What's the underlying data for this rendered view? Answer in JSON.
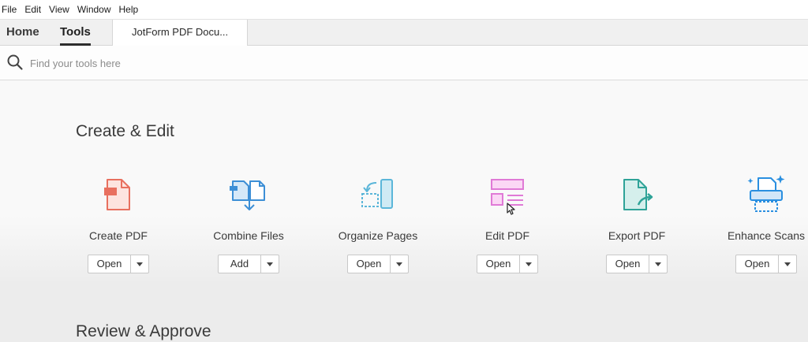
{
  "menu": [
    "File",
    "Edit",
    "View",
    "Window",
    "Help"
  ],
  "tabs": {
    "home": "Home",
    "tools": "Tools",
    "document": "JotForm PDF Docu..."
  },
  "search": {
    "placeholder": "Find your tools here"
  },
  "sections": {
    "create_edit": "Create & Edit",
    "review_approve": "Review & Approve"
  },
  "tools": [
    {
      "label": "Create PDF",
      "action": "Open",
      "icon": "create-pdf-icon",
      "color": "#e8705f"
    },
    {
      "label": "Combine Files",
      "action": "Add",
      "icon": "combine-files-icon",
      "color": "#3d8fd6"
    },
    {
      "label": "Organize Pages",
      "action": "Open",
      "icon": "organize-pages-icon",
      "color": "#5bb6d9"
    },
    {
      "label": "Edit PDF",
      "action": "Open",
      "icon": "edit-pdf-icon",
      "color": "#e07ad6"
    },
    {
      "label": "Export PDF",
      "action": "Open",
      "icon": "export-pdf-icon",
      "color": "#2fa398"
    },
    {
      "label": "Enhance Scans",
      "action": "Open",
      "icon": "enhance-scans-icon",
      "color": "#2a8fe0"
    }
  ]
}
